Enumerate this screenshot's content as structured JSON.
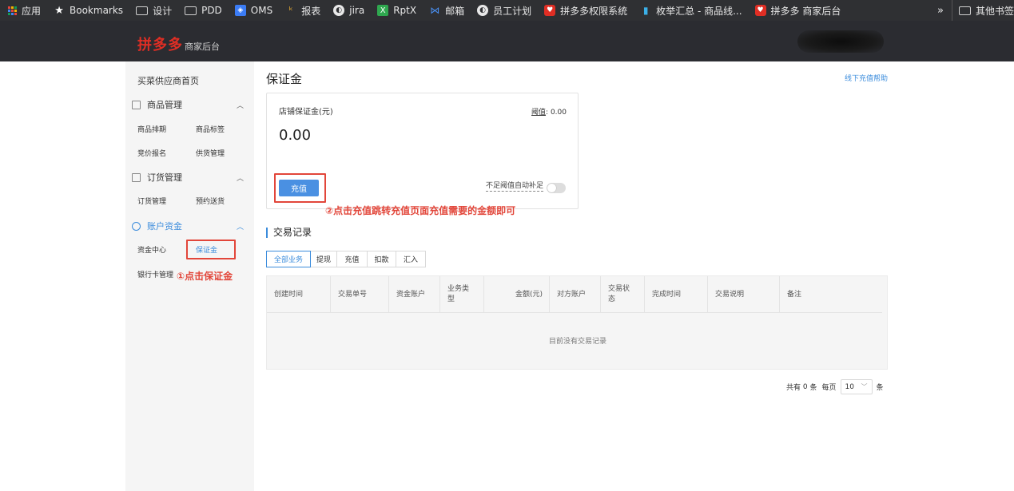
{
  "bookmarks": {
    "items": [
      {
        "label": "应用",
        "icon": "apps-grid-icon"
      },
      {
        "label": "Bookmarks",
        "icon": "star-icon"
      },
      {
        "label": "设计",
        "icon": "folder-icon"
      },
      {
        "label": "PDD",
        "icon": "folder-icon"
      },
      {
        "label": "OMS",
        "icon": "oms-icon"
      },
      {
        "label": "报表",
        "icon": "report-icon"
      },
      {
        "label": "jira",
        "icon": "globe-icon"
      },
      {
        "label": "RptX",
        "icon": "rptx-icon"
      },
      {
        "label": "邮箱",
        "icon": "mail-icon"
      },
      {
        "label": "员工计划",
        "icon": "globe-icon"
      },
      {
        "label": "拼多多权限系统",
        "icon": "pdd-icon"
      },
      {
        "label": "枚举汇总 - 商品线...",
        "icon": "chart-icon"
      },
      {
        "label": "拼多多 商家后台",
        "icon": "pdd-icon"
      }
    ],
    "more": "»",
    "other": "其他书签"
  },
  "header": {
    "logo_main": "拼多多",
    "logo_sub": "商家后台"
  },
  "sidebar": {
    "home": "买菜供应商首页",
    "groups": [
      {
        "label": "商品管理",
        "chevron": "︿",
        "links": [
          "商品排期",
          "商品标签",
          "竞价报名",
          "供货管理"
        ]
      },
      {
        "label": "订货管理",
        "chevron": "︿",
        "links": [
          "订货管理",
          "预约送货"
        ]
      },
      {
        "label": "账户资金",
        "chevron": "︿",
        "links": [
          "资金中心",
          "保证金",
          "银行卡管理"
        ]
      }
    ]
  },
  "main": {
    "title": "保证金",
    "help_link": "线下充值帮助",
    "card": {
      "label": "店铺保证金(元)",
      "threshold_label": "阈值",
      "threshold_sep": ":",
      "threshold_value": "0.00",
      "amount": "0.00",
      "recharge_button": "充值",
      "auto_topup_label": "不足阈值自动补足"
    },
    "section_title": "交易记录",
    "tabs": [
      "全部业务",
      "提现",
      "充值",
      "扣款",
      "汇入"
    ],
    "table": {
      "columns": [
        "创建时间",
        "交易单号",
        "资金账户",
        "业务类型",
        "金额(元)",
        "对方账户",
        "交易状态",
        "完成时间",
        "交易说明",
        "备注"
      ],
      "empty_text": "目前没有交易记录"
    },
    "pager": {
      "total_prefix": "共有",
      "total_count": "0",
      "total_suffix": "条",
      "per_page_label": "每页",
      "per_page_value": "10",
      "per_page_suffix": "条"
    }
  },
  "annotations": {
    "step1": "①点击保证金",
    "step2": "②点击充值跳转充值页面充值需要的金额即可"
  },
  "colors": {
    "accent": "#3b8cdc",
    "brand": "#e02e24",
    "annotation": "#e2463a",
    "button": "#4a90e2"
  }
}
